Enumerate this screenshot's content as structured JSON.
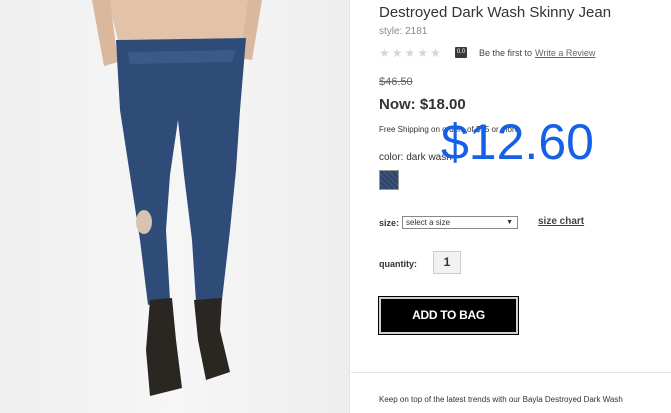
{
  "product": {
    "title": "Destroyed Dark Wash Skinny Jean",
    "style": "style: 2181",
    "stars": "★★★★★",
    "rating_value": "0.0",
    "review_prompt": "Be the first to",
    "review_link": "Write a Review",
    "original_price": "$46.50",
    "current_price": "Now: $18.00",
    "shipping_note": "Free Shipping on orders of $75 or more",
    "color_label": "color: dark wash",
    "overlay_price": "$12.60",
    "size_label": "size:",
    "size_placeholder": "select a size",
    "size_chart_link": "size chart",
    "quantity_label": "quantity:",
    "quantity_value": "1",
    "add_to_bag": "ADD TO BAG",
    "description": "Keep on top of the latest trends with our Bayla Destroyed Dark Wash"
  },
  "colors": {
    "overlay_price": "#1460e6",
    "swatch": "#2d4466",
    "button_bg": "#000000"
  }
}
